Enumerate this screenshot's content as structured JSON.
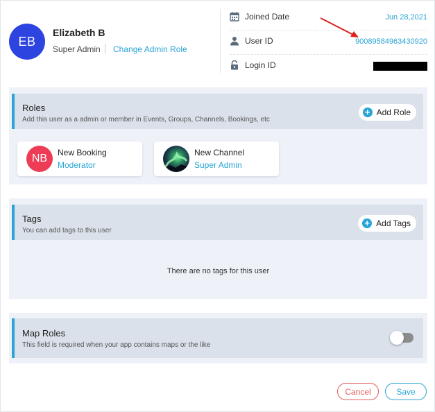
{
  "user": {
    "initials": "EB",
    "name": "Elizabeth B",
    "role": "Super Admin",
    "change_role_label": "Change Admin Role"
  },
  "info": {
    "joined_label": "Joined Date",
    "joined_value": "Jun 28,2021",
    "userid_label": "User ID",
    "userid_value": "90089584963430920",
    "loginid_label": "Login ID"
  },
  "roles": {
    "title": "Roles",
    "subtitle": "Add this user as a admin or member in Events, Groups, Channels, Bookings, etc",
    "add_label": "Add Role",
    "items": [
      {
        "initials": "NB",
        "title": "New Booking",
        "role": "Moderator"
      },
      {
        "title": "New Channel",
        "role": "Super Admin"
      }
    ]
  },
  "tags": {
    "title": "Tags",
    "subtitle": "You can add tags to this user",
    "add_label": "Add Tags",
    "empty_text": "There are no tags for this user"
  },
  "map_roles": {
    "title": "Map Roles",
    "subtitle": "This field is required when your app contains maps or the like",
    "enabled": false
  },
  "footer": {
    "cancel_label": "Cancel",
    "save_label": "Save"
  },
  "colors": {
    "accent": "#2aa4d5",
    "avatar": "#2d44e0",
    "booking_avatar": "#ee3c57",
    "cancel": "#e25a5a",
    "arrow": "#e02020"
  }
}
